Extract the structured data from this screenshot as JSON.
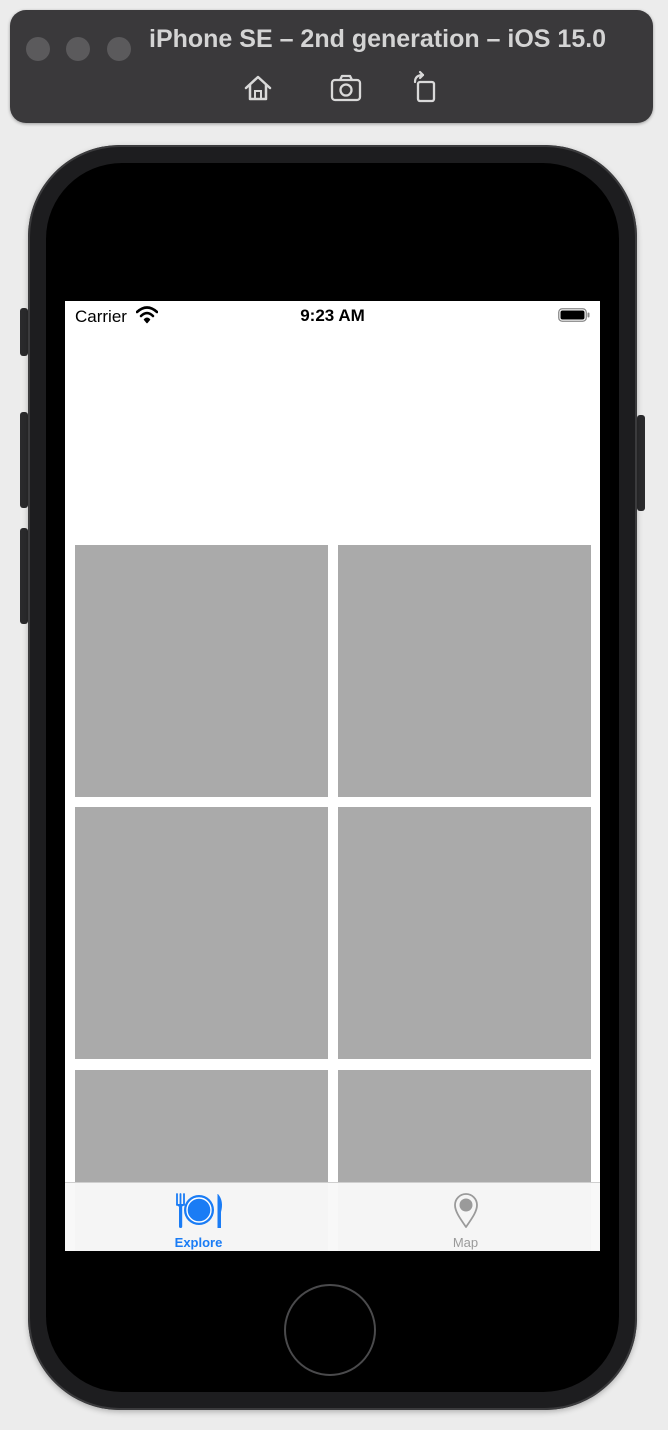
{
  "simulator": {
    "title": "iPhone SE – 2nd generation – iOS 15.0",
    "toolbar": [
      {
        "name": "home",
        "icon": "home-icon"
      },
      {
        "name": "screenshot",
        "icon": "camera-icon"
      },
      {
        "name": "rotate",
        "icon": "rotate-icon"
      }
    ]
  },
  "status_bar": {
    "carrier": "Carrier",
    "time": "9:23 AM",
    "icons": [
      "wifi-icon",
      "battery-icon"
    ]
  },
  "grid": {
    "cell_color": "#aaaaaa",
    "cells": 6
  },
  "tab_bar": {
    "accent_color": "#1a7cf5",
    "inactive_color": "#9a9a9a",
    "tabs": [
      {
        "label": "Explore",
        "icon": "fork-plate-knife-icon",
        "selected": true
      },
      {
        "label": "Map",
        "icon": "map-pin-icon",
        "selected": false
      }
    ]
  }
}
